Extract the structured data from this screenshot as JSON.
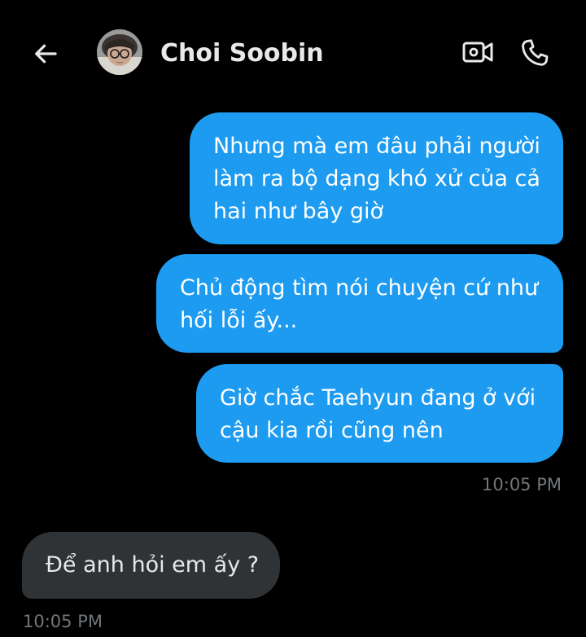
{
  "header": {
    "contact_name": "Choi Soobin",
    "back_icon": "arrow-left-icon",
    "video_icon": "video-camera-icon",
    "call_icon": "phone-icon"
  },
  "messages": [
    {
      "direction": "sent",
      "text": "Nhưng mà em đâu phải người\nlàm ra bộ dạng khó xử của cả\nhai như bây giờ"
    },
    {
      "direction": "sent",
      "text": "Chủ động tìm nói chuyện cứ như\nhối lỗi ấy..."
    },
    {
      "direction": "sent",
      "text": "Giờ chắc Taehyun đang ở với\ncậu kia rồi cũng nên",
      "timestamp": "10:05 PM"
    },
    {
      "direction": "received",
      "text": "Để anh hỏi em ấy ?",
      "timestamp": "10:05 PM"
    }
  ],
  "colors": {
    "background": "#000000",
    "sent_bubble": "#1d9bf0",
    "received_bubble": "#2f3336",
    "primary_text": "#e7e9ea",
    "timestamp_text": "#71767b"
  }
}
